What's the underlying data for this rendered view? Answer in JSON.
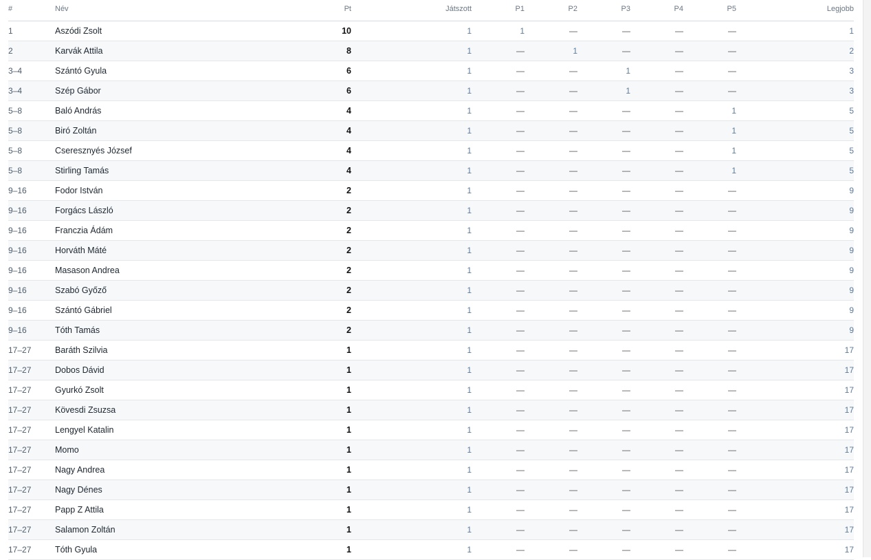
{
  "table": {
    "headers": [
      "#",
      "Név",
      "Pt",
      "Játszott",
      "P1",
      "P2",
      "P3",
      "P4",
      "P5",
      "Legjobb"
    ],
    "rows": [
      [
        "1",
        "Aszódi Zsolt",
        "10",
        "1",
        "1",
        "—",
        "—",
        "—",
        "—",
        "1"
      ],
      [
        "2",
        "Karvák Attila",
        "8",
        "1",
        "—",
        "1",
        "—",
        "—",
        "—",
        "2"
      ],
      [
        "3–4",
        "Szántó Gyula",
        "6",
        "1",
        "—",
        "—",
        "1",
        "—",
        "—",
        "3"
      ],
      [
        "3–4",
        "Szép Gábor",
        "6",
        "1",
        "—",
        "—",
        "1",
        "—",
        "—",
        "3"
      ],
      [
        "5–8",
        "Baló András",
        "4",
        "1",
        "—",
        "—",
        "—",
        "—",
        "1",
        "5"
      ],
      [
        "5–8",
        "Biró Zoltán",
        "4",
        "1",
        "—",
        "—",
        "—",
        "—",
        "1",
        "5"
      ],
      [
        "5–8",
        "Cseresznyés József",
        "4",
        "1",
        "—",
        "—",
        "—",
        "—",
        "1",
        "5"
      ],
      [
        "5–8",
        "Stirling Tamás",
        "4",
        "1",
        "—",
        "—",
        "—",
        "—",
        "1",
        "5"
      ],
      [
        "9–16",
        "Fodor István",
        "2",
        "1",
        "—",
        "—",
        "—",
        "—",
        "—",
        "9"
      ],
      [
        "9–16",
        "Forgács László",
        "2",
        "1",
        "—",
        "—",
        "—",
        "—",
        "—",
        "9"
      ],
      [
        "9–16",
        "Franczia Ádám",
        "2",
        "1",
        "—",
        "—",
        "—",
        "—",
        "—",
        "9"
      ],
      [
        "9–16",
        "Horváth Máté",
        "2",
        "1",
        "—",
        "—",
        "—",
        "—",
        "—",
        "9"
      ],
      [
        "9–16",
        "Masason Andrea",
        "2",
        "1",
        "—",
        "—",
        "—",
        "—",
        "—",
        "9"
      ],
      [
        "9–16",
        "Szabó Győző",
        "2",
        "1",
        "—",
        "—",
        "—",
        "—",
        "—",
        "9"
      ],
      [
        "9–16",
        "Szántó Gábriel",
        "2",
        "1",
        "—",
        "—",
        "—",
        "—",
        "—",
        "9"
      ],
      [
        "9–16",
        "Tóth Tamás",
        "2",
        "1",
        "—",
        "—",
        "—",
        "—",
        "—",
        "9"
      ],
      [
        "17–27",
        "Baráth Szilvia",
        "1",
        "1",
        "—",
        "—",
        "—",
        "—",
        "—",
        "17"
      ],
      [
        "17–27",
        "Dobos Dávid",
        "1",
        "1",
        "—",
        "—",
        "—",
        "—",
        "—",
        "17"
      ],
      [
        "17–27",
        "Gyurkó Zsolt",
        "1",
        "1",
        "—",
        "—",
        "—",
        "—",
        "—",
        "17"
      ],
      [
        "17–27",
        "Kövesdi Zsuzsa",
        "1",
        "1",
        "—",
        "—",
        "—",
        "—",
        "—",
        "17"
      ],
      [
        "17–27",
        "Lengyel Katalin",
        "1",
        "1",
        "—",
        "—",
        "—",
        "—",
        "—",
        "17"
      ],
      [
        "17–27",
        "Momo",
        "1",
        "1",
        "—",
        "—",
        "—",
        "—",
        "—",
        "17"
      ],
      [
        "17–27",
        "Nagy Andrea",
        "1",
        "1",
        "—",
        "—",
        "—",
        "—",
        "—",
        "17"
      ],
      [
        "17–27",
        "Nagy Dénes",
        "1",
        "1",
        "—",
        "—",
        "—",
        "—",
        "—",
        "17"
      ],
      [
        "17–27",
        "Papp Z Attila",
        "1",
        "1",
        "—",
        "—",
        "—",
        "—",
        "—",
        "17"
      ],
      [
        "17–27",
        "Salamon Zoltán",
        "1",
        "1",
        "—",
        "—",
        "—",
        "—",
        "—",
        "17"
      ],
      [
        "17–27",
        "Tóth Gyula",
        "1",
        "1",
        "—",
        "—",
        "—",
        "—",
        "—",
        "17"
      ]
    ]
  },
  "colors": {
    "header_text": "#6b7785",
    "link_blue": "#5d7a99",
    "stripe": "#f6f8fa",
    "border": "#e3e7eb"
  }
}
